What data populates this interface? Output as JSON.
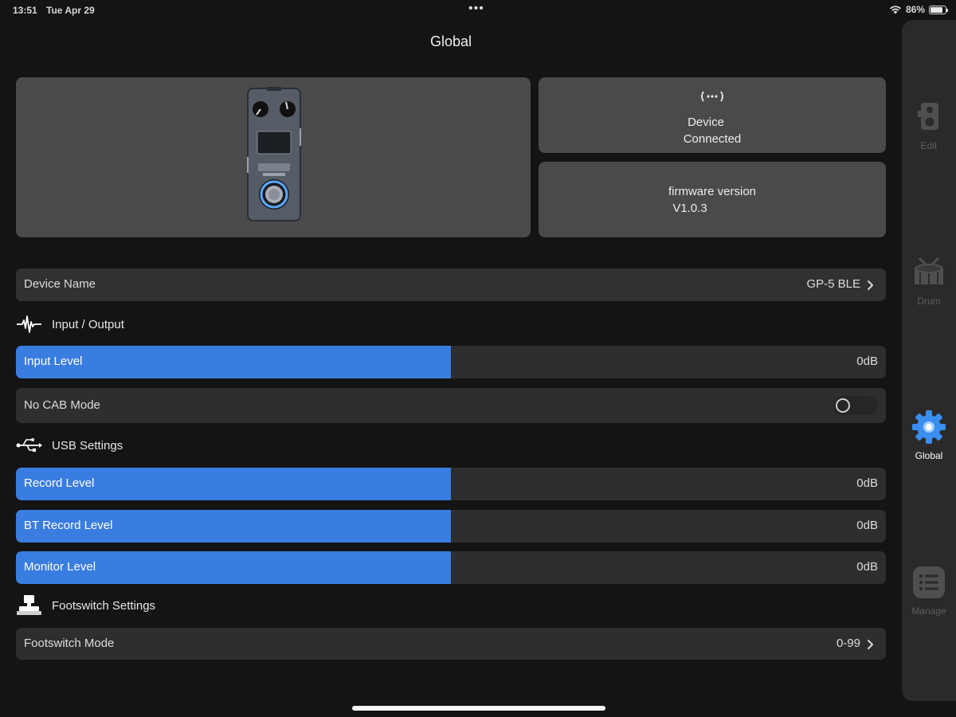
{
  "status_bar": {
    "time": "13:51",
    "date": "Tue Apr 29",
    "battery": "86%",
    "battery_level": 0.86,
    "icons": [
      "more-dots-icon",
      "wifi-icon",
      "battery-icon"
    ]
  },
  "page": {
    "title": "Global"
  },
  "device": {
    "status_icon": "bluetooth-signal-icon",
    "status_line1": "Device",
    "status_line2": "Connected",
    "firmware_label": "firmware version",
    "firmware_value": "V1.0.3",
    "image": "pedal-image"
  },
  "device_name_row": {
    "label": "Device Name",
    "value": "GP-5 BLE"
  },
  "sections": {
    "io": {
      "title": "Input / Output",
      "icon": "waveform-icon"
    },
    "usb": {
      "title": "USB Settings",
      "icon": "usb-icon"
    },
    "footswitch": {
      "title": "Footswitch Settings",
      "icon": "footswitch-icon"
    }
  },
  "sliders": {
    "input": {
      "label": "Input Level",
      "value": "0dB",
      "fill": 0.5
    },
    "record": {
      "label": "Record Level",
      "value": "0dB",
      "fill": 0.5
    },
    "bt_record": {
      "label": "BT Record Level",
      "value": "0dB",
      "fill": 0.5
    },
    "monitor": {
      "label": "Monitor Level",
      "value": "0dB",
      "fill": 0.5
    }
  },
  "toggles": {
    "no_cab": {
      "label": "No CAB Mode",
      "on": false
    }
  },
  "footswitch_mode_row": {
    "label": "Footswitch Mode",
    "value": "0-99"
  },
  "tabs": [
    {
      "label": "Edit",
      "icon": "pedal-icon",
      "active": false
    },
    {
      "label": "Drum",
      "icon": "drum-icon",
      "active": false
    },
    {
      "label": "Global",
      "icon": "gear-icon",
      "active": true
    },
    {
      "label": "Manage",
      "icon": "list-icon",
      "active": false
    }
  ],
  "colors": {
    "accent": "#3a7de0",
    "background": "#141414",
    "card": "#4a4a4a",
    "row": "#2e2e2e"
  }
}
